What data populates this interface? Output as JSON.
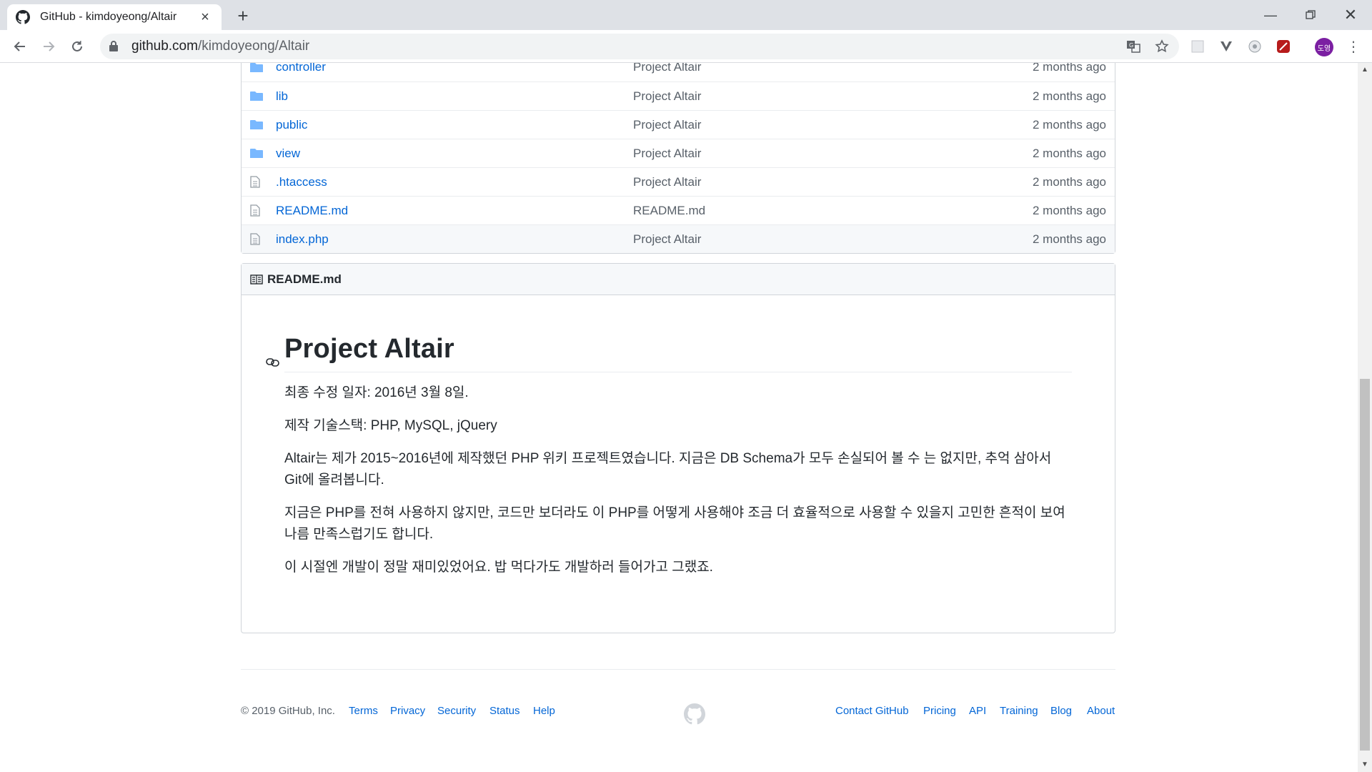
{
  "browser": {
    "tab_title": "GitHub - kimdoyeong/Altair",
    "new_tab": "+",
    "url_host": "github.com",
    "url_path": "/kimdoyeong/Altair",
    "avatar_text": "도영",
    "avatar_color": "#7b1fa2"
  },
  "files": [
    {
      "name": "controller",
      "type": "dir",
      "message": "Project Altair",
      "age": "2 months ago"
    },
    {
      "name": "lib",
      "type": "dir",
      "message": "Project Altair",
      "age": "2 months ago"
    },
    {
      "name": "public",
      "type": "dir",
      "message": "Project Altair",
      "age": "2 months ago"
    },
    {
      "name": "view",
      "type": "dir",
      "message": "Project Altair",
      "age": "2 months ago"
    },
    {
      "name": ".htaccess",
      "type": "file",
      "message": "Project Altair",
      "age": "2 months ago"
    },
    {
      "name": "README.md",
      "type": "file",
      "message": "README.md",
      "age": "2 months ago"
    },
    {
      "name": "index.php",
      "type": "file",
      "message": "Project Altair",
      "age": "2 months ago"
    }
  ],
  "readme": {
    "header": "README.md",
    "title": "Project Altair",
    "paragraphs": [
      "최종 수정 일자: 2016년 3월 8일.",
      "제작 기술스택: PHP, MySQL, jQuery",
      "Altair는 제가 2015~2016년에 제작했던 PHP 위키 프로젝트였습니다. 지금은 DB Schema가 모두 손실되어 볼 수 는 없지만, 추억 삼아서 Git에 올려봅니다.",
      "지금은 PHP를 전혀 사용하지 않지만, 코드만 보더라도 이 PHP를 어떻게 사용해야 조금 더 효율적으로 사용할 수 있을지 고민한 흔적이 보여 나름 만족스럽기도 합니다.",
      "이 시절엔 개발이 정말 재미있었어요. 밥 먹다가도 개발하러 들어가고 그랬죠."
    ]
  },
  "footer": {
    "copyright": "© 2019 GitHub, Inc.",
    "left_links": [
      "Terms",
      "Privacy",
      "Security",
      "Status",
      "Help"
    ],
    "right_links": [
      "Contact GitHub",
      "Pricing",
      "API",
      "Training",
      "Blog",
      "About"
    ]
  },
  "colors": {
    "link": "#0366d6",
    "folder": "#79b8ff",
    "muted": "#586069"
  }
}
